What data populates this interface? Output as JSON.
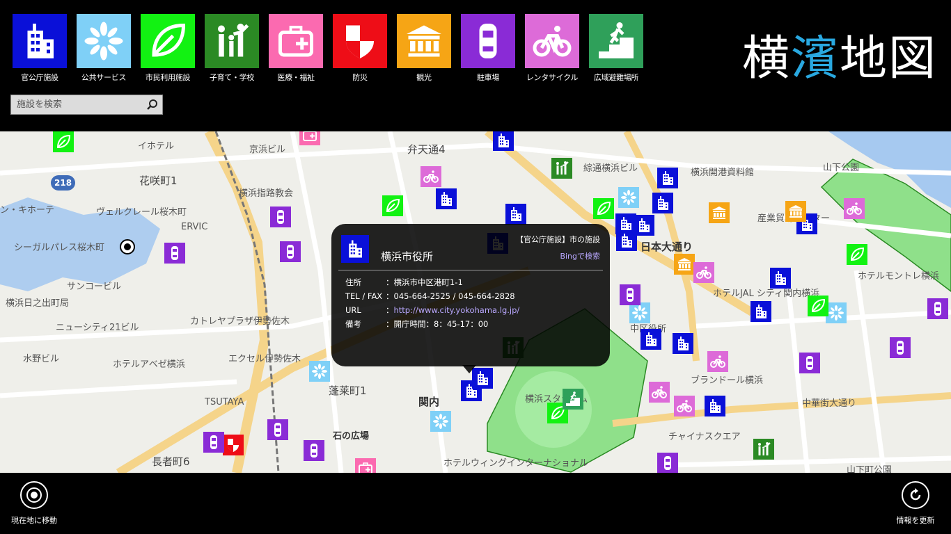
{
  "app": {
    "title_prefix": "横",
    "title_accent": "濱",
    "title_suffix": "地図"
  },
  "categories": [
    {
      "label": "官公庁施設",
      "color": "#0a10d8",
      "icon": "building-icon"
    },
    {
      "label": "公共サービス",
      "color": "#7fd0f7",
      "icon": "flower-icon"
    },
    {
      "label": "市民利用施設",
      "color": "#12f212",
      "icon": "leaf-icon"
    },
    {
      "label": "子育て・学校",
      "color": "#2b8a24",
      "icon": "family-icon"
    },
    {
      "label": "医療・福祉",
      "color": "#fb6ab0",
      "icon": "first-aid-icon"
    },
    {
      "label": "防災",
      "color": "#ee0d17",
      "icon": "shield-icon"
    },
    {
      "label": "観光",
      "color": "#f6a515",
      "icon": "museum-icon"
    },
    {
      "label": "駐車場",
      "color": "#8a2bd6",
      "icon": "car-icon"
    },
    {
      "label": "レンタサイクル",
      "color": "#dd6bd8",
      "icon": "bicycle-icon"
    },
    {
      "label": "広域避難場所",
      "color": "#2fa05a",
      "icon": "evacuation-icon"
    }
  ],
  "search": {
    "placeholder": "施設を検索"
  },
  "map_labels": {
    "benten": "弁天通4",
    "hanasaki": "花咲町1",
    "kannai": "関内",
    "horaicho": "蓬莱町1",
    "nihon_odori": "日本大通り",
    "chukagai": "中華街大通り",
    "chojamachi": "長者町6",
    "ishi_hiroba": "石の広場",
    "yokohama_stadium": "横浜スタジアム",
    "chinatown": "チャイナスクエア",
    "kaiko": "横浜開港資料館",
    "yamashita": "山下公園",
    "naka_ku": "中区役所",
    "r218": "218",
    "ervic": "ERVIC",
    "seagull": "シーガルパレス桜木町",
    "welcreer": "ヴェルクレール桜木町",
    "kinki": "ン・キホーテ",
    "sunny": "サンコービル",
    "hinode": "横浜日之出町局",
    "newcity": "ニューシティ21ビル",
    "mizuno": "水野ビル",
    "avezi": "ホテルアベゼ横浜",
    "tsutaya": "TSUTAYA",
    "kyoubun": "京浜ビル",
    "shidou": "横浜指路教会",
    "yokohamasanbanki": "綜通横浜ビル",
    "hotelmontrey": "ホテルモントレ横浜",
    "brandor": "ブランドール横浜",
    "wing": "ホテルウィングインターナショナル",
    "kaeko": "カトレヤプラザ伊勢佐木",
    "excel": "エクセル伊勢佐木",
    "irihei": "イホテル",
    "ryokkan": "山下町公園",
    "shounan": "ホテルJAL シティ関内横浜",
    "sangyo": "産業貿易センター"
  },
  "popup": {
    "name": "横浜市役所",
    "category": "【官公庁施設】市の施設",
    "bing": "Bingで検索",
    "rows": [
      {
        "key": "住所",
        "value": "：横浜市中区港町1-1"
      },
      {
        "key": "TEL / FAX",
        "value": "：045-664-2525 /  045-664-2828"
      },
      {
        "key": "URL",
        "value": "http://www.city.yokohama.lg.jp/",
        "prefix": "："
      },
      {
        "key": "備考",
        "value": "：開庁時間：8：45-17：00"
      }
    ]
  },
  "appbar": {
    "locate": "現在地に移動",
    "refresh": "情報を更新"
  }
}
